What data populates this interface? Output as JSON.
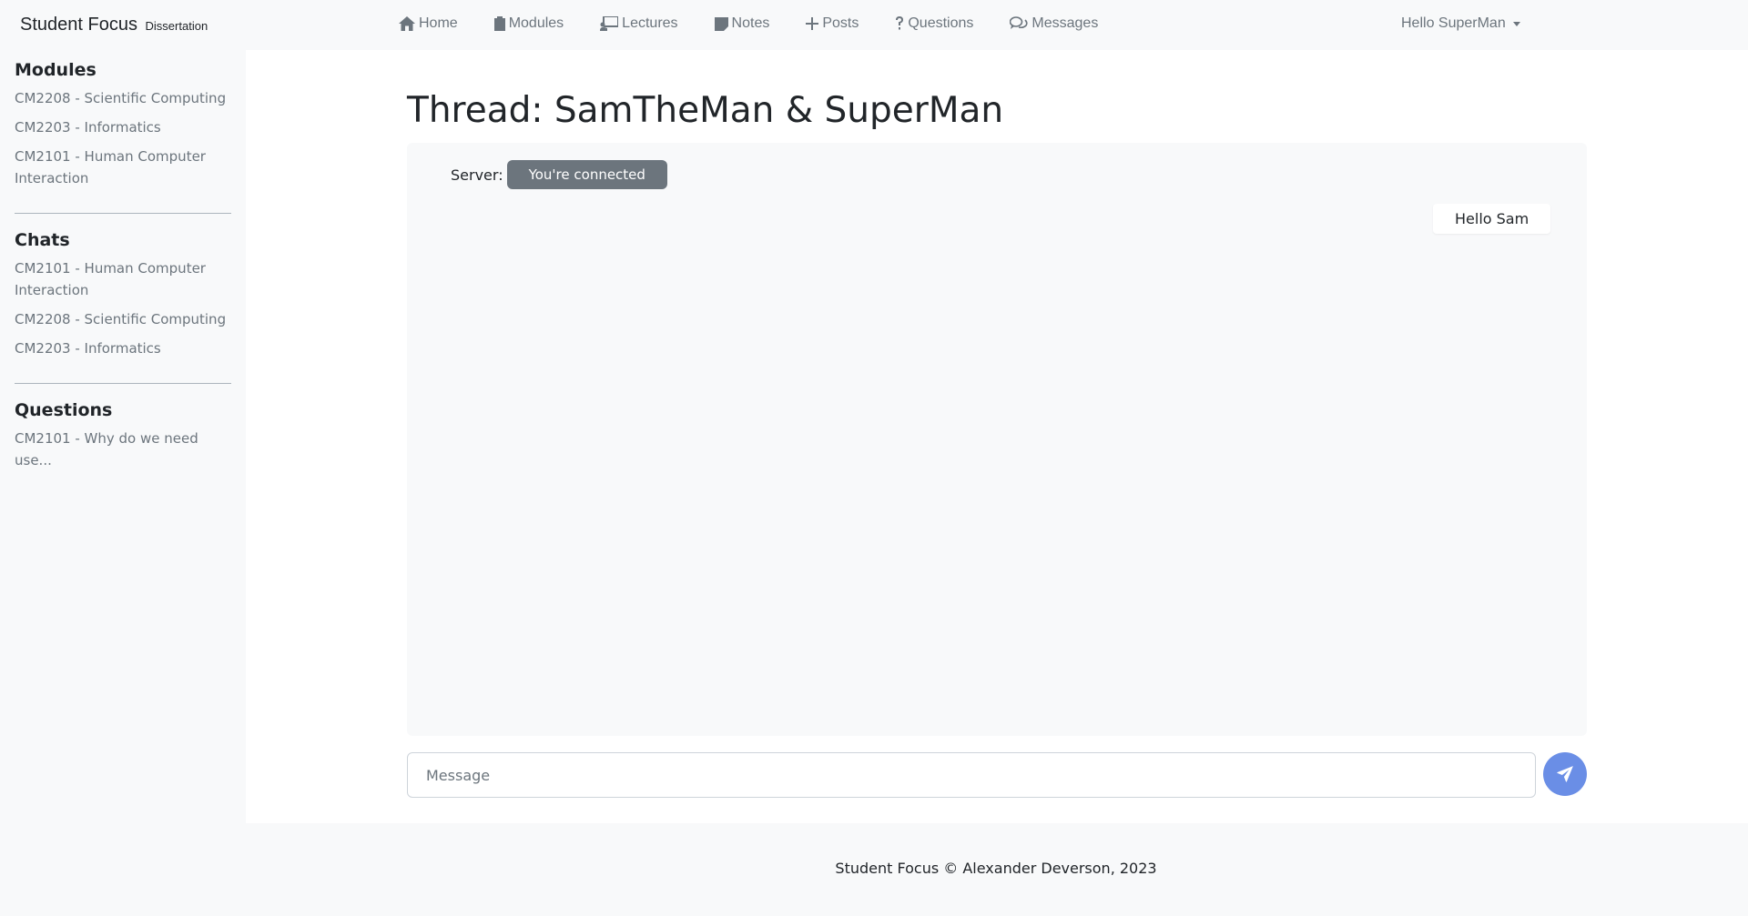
{
  "brand": {
    "name": "Student Focus",
    "sub": "Dissertation"
  },
  "nav": [
    {
      "label": "Home",
      "icon": "home-icon"
    },
    {
      "label": "Modules",
      "icon": "clipboard-icon"
    },
    {
      "label": "Lectures",
      "icon": "presentation-icon"
    },
    {
      "label": "Notes",
      "icon": "note-icon"
    },
    {
      "label": "Posts",
      "icon": "plus-icon"
    },
    {
      "label": "Questions",
      "icon": "question-icon"
    },
    {
      "label": "Messages",
      "icon": "chat-bubbles-icon"
    }
  ],
  "user_menu": {
    "label": "Hello SuperMan"
  },
  "sidebar": {
    "modules": {
      "heading": "Modules",
      "items": [
        "CM2208 - Scientific Computing",
        "CM2203 - Informatics",
        "CM2101 - Human Computer Interaction"
      ]
    },
    "chats": {
      "heading": "Chats",
      "items": [
        "CM2101 - Human Computer Interaction",
        "CM2208 - Scientific Computing",
        "CM2203 - Informatics"
      ]
    },
    "questions": {
      "heading": "Questions",
      "items": [
        "CM2101 - Why do we need use..."
      ]
    }
  },
  "thread": {
    "title": "Thread: SamTheMan & SuperMan",
    "server_label": "Server:",
    "server_status": "You're connected",
    "messages": [
      {
        "text": "Hello Sam"
      }
    ],
    "input_placeholder": "Message"
  },
  "footer": {
    "text": "Student Focus © Alexander Deverson, 2023"
  },
  "colors": {
    "accent": "#6a8ee6",
    "badge": "#6c757d",
    "muted": "#6c757d"
  }
}
